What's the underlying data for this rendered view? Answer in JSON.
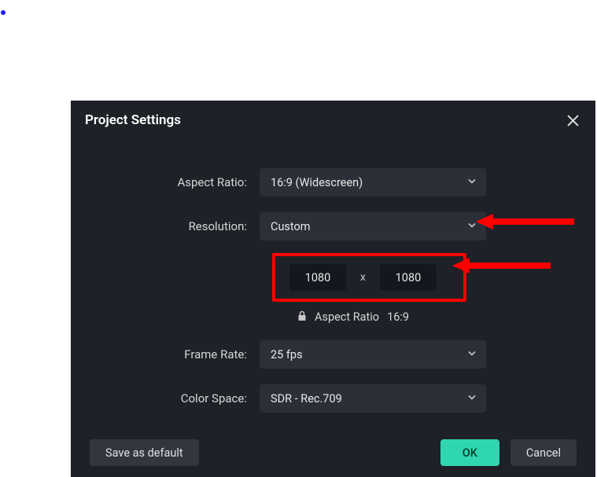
{
  "dialog": {
    "title": "Project Settings",
    "labels": {
      "aspect_ratio": "Aspect Ratio:",
      "resolution": "Resolution:",
      "frame_rate": "Frame Rate:",
      "color_space": "Color Space:"
    },
    "values": {
      "aspect_ratio": "16:9 (Widescreen)",
      "resolution": "Custom",
      "width": "1080",
      "height": "1080",
      "size_separator": "x",
      "locked_ratio_label": "Aspect Ratio",
      "locked_ratio_value": "16:9",
      "frame_rate": "25 fps",
      "color_space": "SDR - Rec.709"
    },
    "buttons": {
      "save_default": "Save as default",
      "ok": "OK",
      "cancel": "Cancel"
    }
  }
}
